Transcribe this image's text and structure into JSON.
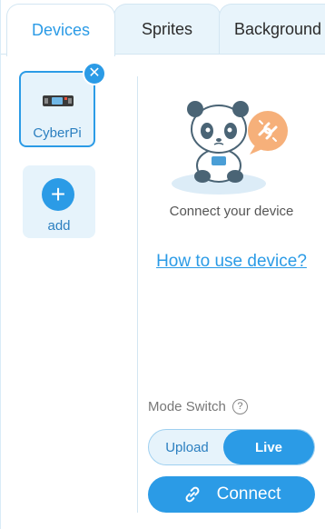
{
  "tabs": [
    {
      "label": "Devices",
      "active": true
    },
    {
      "label": "Sprites",
      "active": false
    },
    {
      "label": "Background",
      "active": false
    }
  ],
  "devices": {
    "items": [
      {
        "name": "CyberPi",
        "selected": true
      }
    ],
    "add_label": "add"
  },
  "connect_hint": "Connect your device",
  "how_to_link": "How to use device?",
  "mode_switch": {
    "label": "Mode Switch",
    "help_icon": "?",
    "options": [
      "Upload",
      "Live"
    ],
    "selected": "Live"
  },
  "connect_button": {
    "label": "Connect",
    "icon": "link-icon"
  },
  "colors": {
    "accent": "#2b9be6",
    "light_bg": "#e6f3fb"
  }
}
